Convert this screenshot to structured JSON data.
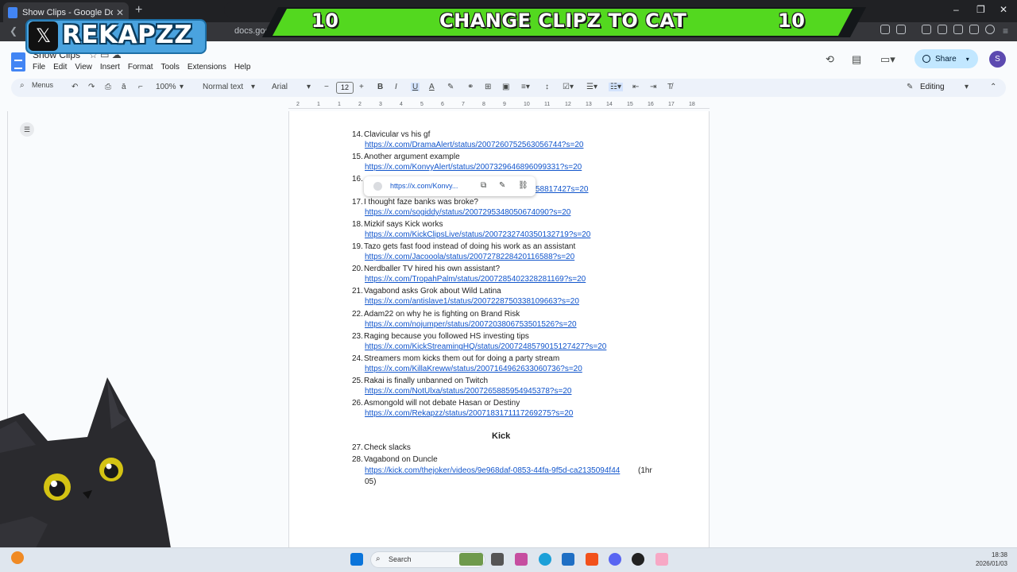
{
  "browser": {
    "tab_title": "Show Clips - Google Docs",
    "tab_close": "✕",
    "new_tab": "+",
    "address": "docs.goo",
    "win_controls": [
      "–",
      "❐",
      "✕"
    ]
  },
  "overlay": {
    "left_counter": "10",
    "center_text": "CHANGE CLIPZ TO CAT",
    "right_counter": "10",
    "handle": "REKAPZZ",
    "x_logo": "𝕏"
  },
  "docs": {
    "title": "Show Clips",
    "menu": [
      "File",
      "Edit",
      "View",
      "Insert",
      "Format",
      "Tools",
      "Extensions",
      "Help"
    ],
    "share_label": "Share",
    "avatar_letter": "S",
    "toolbar": {
      "menus_label": "Menus",
      "zoom": "100%",
      "style": "Normal text",
      "font": "Arial",
      "font_size": "12",
      "mode": "Editing"
    },
    "ruler_marks": [
      "2",
      "1",
      "1",
      "2",
      "3",
      "4",
      "5",
      "6",
      "7",
      "8",
      "9",
      "10",
      "11",
      "12",
      "13",
      "14",
      "15",
      "16",
      "17",
      "18"
    ]
  },
  "doc_entries": [
    {
      "num": "14.",
      "text": "Clavicular vs his gf",
      "link": "https://x.com/DramaAlert/status/2007260752563056744?s=20"
    },
    {
      "num": "15.",
      "text": "Another argument example",
      "link": "https://x.com/KonvyAlert/status/2007329646896099331?s=20"
    },
    {
      "num": "16.",
      "text": "",
      "link": "58817427s=20"
    },
    {
      "num": "17.",
      "text": "I thought faze banks was broke?",
      "link": "https://x.com/sogiddy/status/2007295348050674090?s=20"
    },
    {
      "num": "18.",
      "text": "Mizkif says Kick works",
      "link": "https://x.com/KickClipsLive/status/2007232740350132719?s=20"
    },
    {
      "num": "19.",
      "text": "Tazo gets fast food instead of doing his work as an assistant",
      "link": "https://x.com/Jacooola/status/2007278228420116588?s=20"
    },
    {
      "num": "20.",
      "text": "Nerdballer TV hired his own assistant?",
      "link": "https://x.com/TropahPalm/status/2007285402328281169?s=20"
    },
    {
      "num": "21.",
      "text": "Vagabond asks Grok about Wild Latina",
      "link": "https://x.com/antislave1/status/2007228750338109663?s=20"
    },
    {
      "num": "22.",
      "text": "Adam22 on why he is fighting on Brand Risk",
      "link": "https://x.com/nojumper/status/2007203806753501526?s=20"
    },
    {
      "num": "23.",
      "text": "Raging because you followed HS investing tips",
      "link": "https://x.com/KickStreamingHQ/status/2007248579015127427?s=20"
    },
    {
      "num": "24.",
      "text": "Streamers mom kicks them out for doing a party stream",
      "link": "https://x.com/KillaKreww/status/2007164962633060736?s=20"
    },
    {
      "num": "25.",
      "text": "Rakai is finally unbanned on Twitch",
      "link": "https://x.com/NotUlxa/status/2007265885954945378?s=20"
    },
    {
      "num": "26.",
      "text": "Asmongold will not debate Hasan or Destiny",
      "link": "https://x.com/Rekapzz/status/2007183171117269275?s=20"
    }
  ],
  "kick_section": {
    "heading": "Kick",
    "item27": {
      "num": "27.",
      "text": "Check slacks"
    },
    "item28": {
      "num": "28.",
      "text": "Vagabond on Duncle",
      "link": "https://kick.com/thejoker/videos/9e968daf-0853-44fa-9f5d-ca2135094f44",
      "suffix": " (1hr",
      "suffix2": "05)"
    }
  },
  "link_popup": {
    "url": "https://x.com/Konvy..."
  },
  "taskbar": {
    "search_label": "Search",
    "time": "18:38",
    "date": "2026/01/03"
  },
  "colors": {
    "banner_green": "#53d81f",
    "link_blue": "#1155cc",
    "share_bg": "#c2e7ff"
  }
}
